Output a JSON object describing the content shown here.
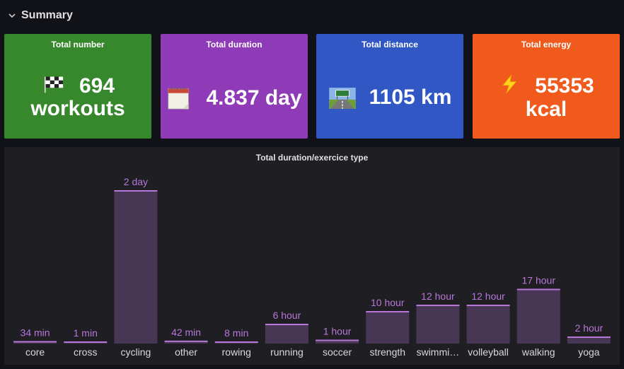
{
  "row": {
    "title": "Summary"
  },
  "stats": [
    {
      "title": "Total number",
      "value_line1": "694",
      "value_line2": "workouts",
      "icon": "checkered-flag-icon",
      "color": "#37872d"
    },
    {
      "title": "Total duration",
      "value_line1": "4.837 day",
      "icon": "calendar-icon",
      "color": "#8f3bb8"
    },
    {
      "title": "Total distance",
      "value_line1": "1105 km",
      "icon": "highway-icon",
      "color": "#3057c4"
    },
    {
      "title": "Total energy",
      "value_line1": "55353",
      "value_line2": "kcal",
      "icon": "lightning-icon",
      "color": "#f05a1c"
    }
  ],
  "chart_data": {
    "type": "bar",
    "title": "Total duration/exercice type",
    "categories": [
      "core",
      "cross",
      "cycling",
      "other",
      "rowing",
      "running",
      "soccer",
      "strength",
      "swimmi…",
      "volleyball",
      "walking",
      "yoga"
    ],
    "values_hours": [
      0.567,
      0.017,
      48,
      0.7,
      0.133,
      6,
      1,
      10,
      12,
      12,
      17,
      2
    ],
    "value_labels": [
      "34 min",
      "1 min",
      "2 day",
      "42 min",
      "8 min",
      "6 hour",
      "1 hour",
      "10 hour",
      "12 hour",
      "12 hour",
      "17 hour",
      "2 hour"
    ],
    "ylim": [
      0,
      48
    ],
    "bar_color": "#b877d9",
    "grid": false
  }
}
